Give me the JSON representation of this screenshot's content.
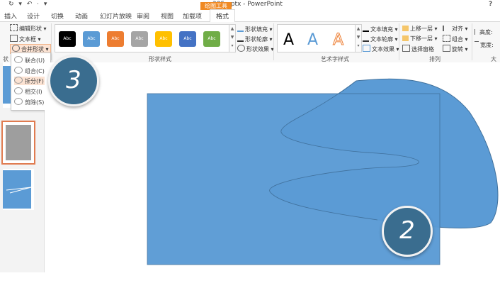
{
  "titlebar": {
    "qat_icons": "↻ ▾ ↶ · ▾",
    "title": "385.pptx - PowerPoint",
    "context_tab": "绘图工具",
    "help": "?"
  },
  "tabs": [
    "插入",
    "设计",
    "切换",
    "动画",
    "幻灯片放映",
    "审阅",
    "视图",
    "加载项",
    "格式"
  ],
  "ribbon": {
    "insert_shapes": {
      "edit_shape": "编辑形状 ▾",
      "text_box": "文本框 ▾",
      "merge_shapes": "合并形状 ▾",
      "group_label": "状"
    },
    "shape_styles": {
      "swatch_label": "Abc",
      "swatches": [
        "#000000",
        "#5b9bd5",
        "#ed7d31",
        "#a5a5a5",
        "#ffc000",
        "#4472c4",
        "#70ad47"
      ],
      "fill": "形状填充 ▾",
      "outline": "形状轮廓 ▾",
      "effects": "形状效果 ▾",
      "group_label": "形状样式"
    },
    "wordart": {
      "letters": [
        "A",
        "A",
        "A"
      ],
      "text_fill": "文本填充 ▾",
      "text_outline": "文本轮廓 ▾",
      "text_effects": "文本效果 ▾",
      "group_label": "艺术字样式"
    },
    "arrange": {
      "bring_forward": "上移一层 ▾",
      "send_backward": "下移一层 ▾",
      "selection_pane": "选择窗格",
      "align": "对齐 ▾",
      "group": "组合 ▾",
      "rotate": "旋转 ▾",
      "group_label": "排列"
    },
    "size": {
      "height": "高度:",
      "width": "宽度:",
      "group_label": "大"
    }
  },
  "dropdown": {
    "items": [
      "联合(U)",
      "组合(C)",
      "拆分(F)",
      "相交(I)",
      "剪除(S)"
    ],
    "selected_index": 2
  },
  "annotations": {
    "badge_a": "3",
    "badge_b": "2"
  },
  "colors": {
    "accent": "#5b9bd5",
    "context_tab": "#f08a24",
    "badge": "#3a6d8f"
  }
}
